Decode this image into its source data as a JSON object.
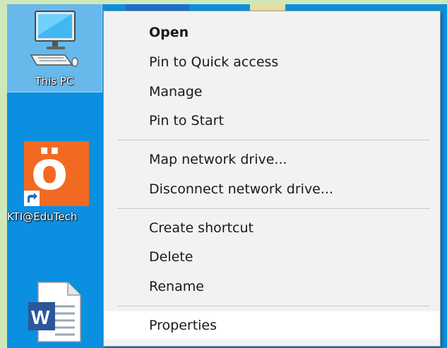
{
  "desktop": {
    "icons": [
      {
        "label": "This PC",
        "icon": "computer-icon"
      },
      {
        "label": "KTI@EduTech",
        "icon": "app-shortcut-icon",
        "glyph": "ö"
      },
      {
        "label": "",
        "icon": "word-document-icon",
        "glyph": "W"
      }
    ],
    "colors": {
      "desktop": "#0b8fe0",
      "menu": "#f2f2f2",
      "hover": "#ffffff"
    }
  },
  "context_menu": {
    "items": [
      {
        "label": "Open"
      },
      {
        "label": "Pin to Quick access"
      },
      {
        "label": "Manage"
      },
      {
        "label": "Pin to Start"
      },
      {
        "label": "Map network drive..."
      },
      {
        "label": "Disconnect network drive..."
      },
      {
        "label": "Create shortcut"
      },
      {
        "label": "Delete"
      },
      {
        "label": "Rename"
      },
      {
        "label": "Properties"
      }
    ]
  }
}
